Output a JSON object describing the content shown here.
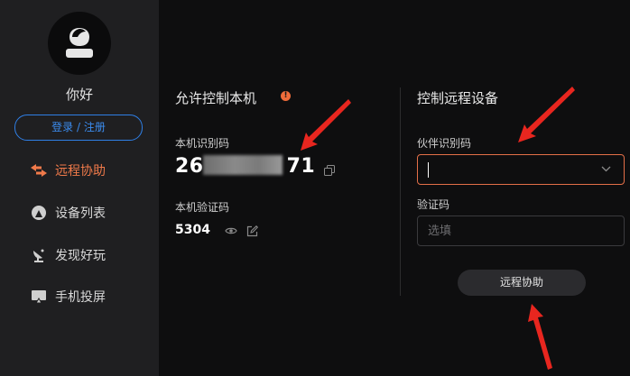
{
  "sidebar": {
    "username": "你好",
    "login_label": "登录 / 注册",
    "items": [
      {
        "label": "远程协助",
        "icon": "remote-assist-icon",
        "active": true
      },
      {
        "label": "设备列表",
        "icon": "device-list-icon",
        "active": false
      },
      {
        "label": "发现好玩",
        "icon": "discover-icon",
        "active": false
      },
      {
        "label": "手机投屏",
        "icon": "screen-cast-icon",
        "active": false
      }
    ]
  },
  "allow": {
    "title": "允许控制本机",
    "warning_glyph": "!",
    "id_label": "本机识别码",
    "id_value_visible": "26",
    "id_value_end": "71",
    "code_label": "本机验证码",
    "code_value": "5304"
  },
  "control": {
    "title": "控制远程设备",
    "partner_label": "伙伴识别码",
    "partner_value": "",
    "code_label": "验证码",
    "code_placeholder": "选填",
    "assist_button": "远程协助"
  },
  "colors": {
    "accent": "#f07a4a",
    "link_blue": "#3b8cf0",
    "annotation_red": "#e8261f"
  }
}
